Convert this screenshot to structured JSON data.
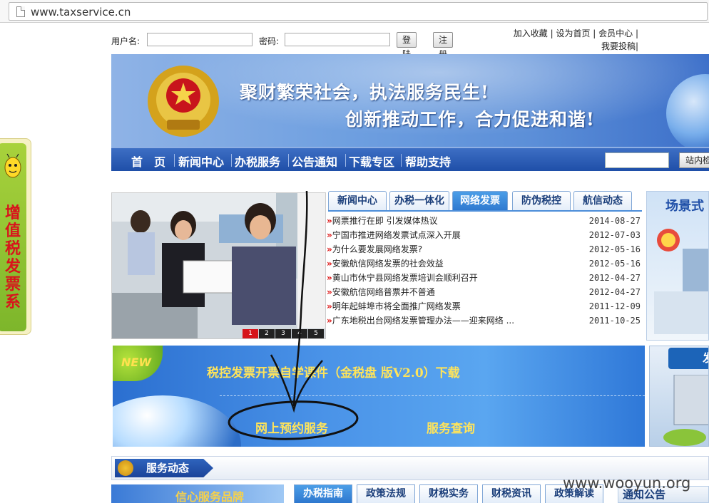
{
  "browser": {
    "url": "www.taxservice.cn"
  },
  "login": {
    "username_label": "用户名:",
    "password_label": "密码:",
    "login_button": "登陆",
    "register_button": "注册"
  },
  "top_links": [
    "加入收藏",
    "设为首页",
    "会员中心",
    "我要投稿"
  ],
  "banner": {
    "slogan_line1": "聚财繁荣社会，执法服务民生!",
    "slogan_line2": "创新推动工作，合力促进和谐!"
  },
  "nav": {
    "items": [
      "首　页",
      "新闻中心",
      "办税服务",
      "公告通知",
      "下载专区",
      "帮助支持"
    ],
    "search_button": "站内检索"
  },
  "side_badge": {
    "text": "增值税发票系"
  },
  "slider": {
    "dots": [
      "1",
      "2",
      "3",
      "4",
      "5"
    ],
    "active": 1
  },
  "news_tabs": {
    "tabs": [
      "新闻中心",
      "办税一体化",
      "网络发票",
      "防伪税控",
      "航信动态"
    ],
    "active": "网络发票"
  },
  "news": [
    {
      "title": "网票推行在即 引发媒体热议",
      "date": "2014-08-27"
    },
    {
      "title": "宁国市推进网络发票试点深入开展",
      "date": "2012-07-03"
    },
    {
      "title": "为什么要发展网络发票?",
      "date": "2012-05-16"
    },
    {
      "title": "安徽航信网络发票的社会效益",
      "date": "2012-05-16"
    },
    {
      "title": "黄山市休宁县网络发票培训会顺利召开",
      "date": "2012-04-27"
    },
    {
      "title": "安徽航信网络普票并不普通",
      "date": "2012-04-27"
    },
    {
      "title": "明年起蚌埠市将全面推广网络发票",
      "date": "2011-12-09"
    },
    {
      "title": "广东地税出台网络发票管理办法——迎来网络 ...",
      "date": "2011-10-25"
    }
  ],
  "promo_right": {
    "title": "场景式"
  },
  "promo_band": {
    "new_badge": "NEW",
    "download_text": "税控发票开票自学课件（金税盘 版V2.0）下载",
    "appointment_link": "网上预约服务",
    "query_link": "服务查询"
  },
  "side_right2": {
    "ribbon": "发"
  },
  "service_bar": {
    "label": "服务动态"
  },
  "bottom": {
    "image_text": "信心服务品牌",
    "tabs": [
      "办税指南",
      "政策法规",
      "财税实务",
      "财税资讯",
      "政策解读"
    ],
    "active": "办税指南",
    "notice": "通知公告"
  },
  "watermark": "www.wooyun.org",
  "colors": {
    "nav_blue": "#1f4fa8",
    "tab_active": "#2e78cf",
    "highlight_yellow": "#ffe45a",
    "badge_red": "#d8141c"
  }
}
